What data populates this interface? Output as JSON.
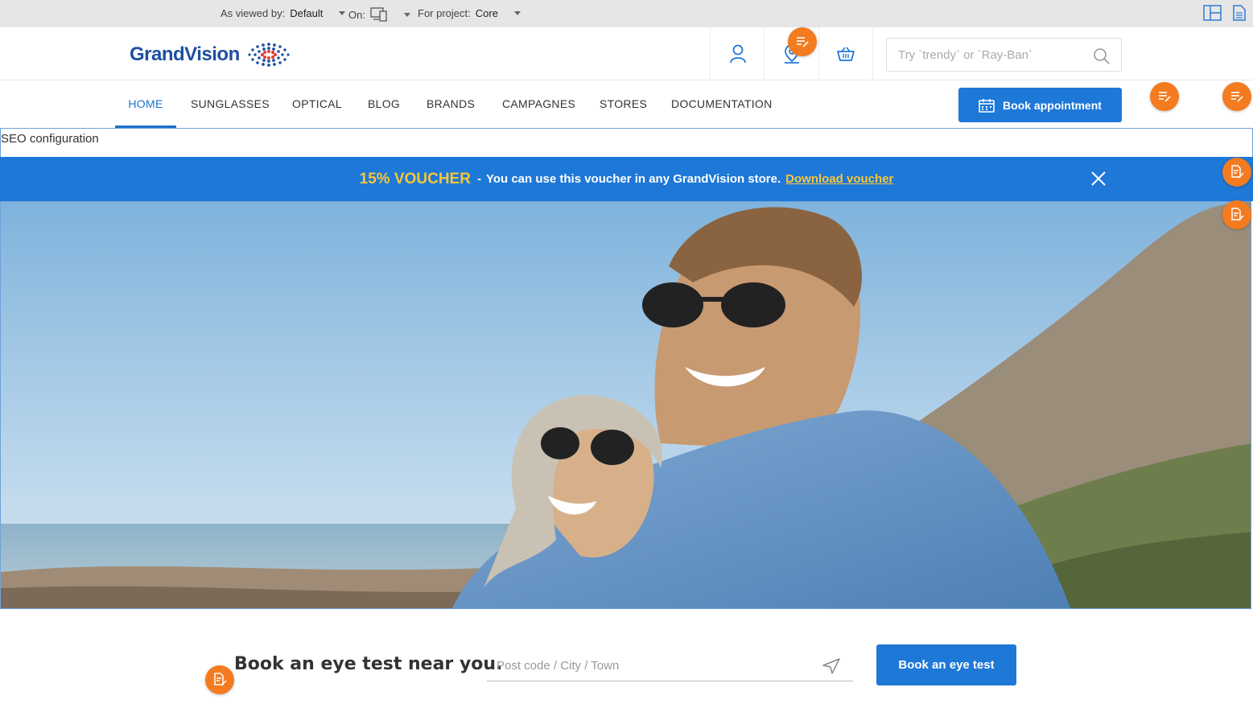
{
  "topbar": {
    "viewed_by_label": "As viewed by:",
    "viewed_by_value": "Default",
    "on_label": "On:",
    "project_label": "For project:",
    "project_value": "Core"
  },
  "header": {
    "logo_text": "GrandVision",
    "search_placeholder": "Try `trendy` or `Ray-Ban`"
  },
  "nav": {
    "items": [
      {
        "label": "HOME",
        "active": true
      },
      {
        "label": "SUNGLASSES"
      },
      {
        "label": "OPTICAL"
      },
      {
        "label": "BLOG"
      },
      {
        "label": "BRANDS"
      },
      {
        "label": "CAMPAGNES"
      },
      {
        "label": "STORES"
      },
      {
        "label": "DOCUMENTATION"
      }
    ],
    "book_label": "Book appointment"
  },
  "seo": {
    "label": "SEO configuration"
  },
  "voucher": {
    "title": "15% VOUCHER",
    "separator": "-",
    "text": "You can use this voucher in any GrandVision store.",
    "link": "Download voucher"
  },
  "eye_test": {
    "title": "Book an eye test near you.",
    "placeholder": "Post code / City / Town",
    "button": "Book an eye test"
  },
  "colors": {
    "primary": "#1e78d7",
    "accent": "#f7c63a",
    "edit": "#f47b20"
  }
}
